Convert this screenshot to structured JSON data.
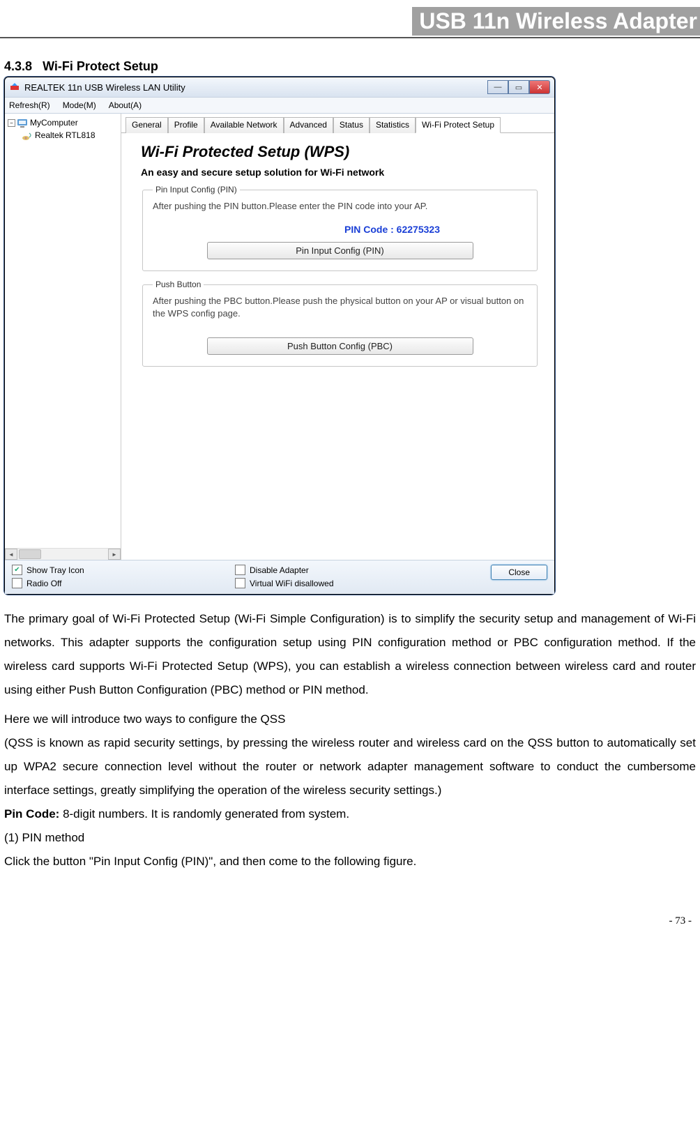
{
  "header": {
    "title": "USB 11n Wireless Adapter"
  },
  "section": {
    "number": "4.3.8",
    "title": "Wi-Fi Protect Setup"
  },
  "window": {
    "title": "REALTEK 11n USB Wireless LAN Utility",
    "menu": {
      "refresh": "Refresh(R)",
      "mode": "Mode(M)",
      "about": "About(A)"
    },
    "tree": {
      "root": "MyComputer",
      "child": "Realtek RTL818"
    },
    "tabs": {
      "general": "General",
      "profile": "Profile",
      "available": "Available Network",
      "advanced": "Advanced",
      "status": "Status",
      "statistics": "Statistics",
      "wps": "Wi-Fi Protect Setup"
    },
    "panel": {
      "heading": "Wi-Fi Protected Setup (WPS)",
      "subheading": "An easy and secure setup solution for Wi-Fi network",
      "pin_group": {
        "legend": "Pin Input Config (PIN)",
        "desc": "After pushing the PIN button.Please enter the PIN code into your AP.",
        "pincode_label": "PIN Code :  62275323",
        "button": "Pin Input Config (PIN)"
      },
      "pbc_group": {
        "legend": "Push Button",
        "desc": "After pushing the PBC button.Please push the physical button on your AP or visual button on the WPS config page.",
        "button": "Push Button Config (PBC)"
      }
    },
    "bottom": {
      "show_tray": "Show Tray Icon",
      "radio_off": "Radio Off",
      "disable_adapter": "Disable Adapter",
      "virtual_wifi": "Virtual WiFi disallowed",
      "close": "Close"
    }
  },
  "body": {
    "p1": "The primary goal of Wi-Fi Protected Setup (Wi-Fi Simple Configuration) is to simplify the security setup and management of Wi-Fi networks. This adapter supports the configuration setup using PIN configuration method or PBC configuration method. If the wireless card supports Wi-Fi Protected Setup (WPS), you can establish a wireless connection between wireless card and router using either Push Button Configuration (PBC) method or PIN method.",
    "p2": "Here we will introduce two ways to configure the QSS",
    "p3": "(QSS is known as rapid security settings, by pressing the wireless router and wireless card on the QSS button to automatically set up WPA2 secure connection level without the router or network adapter management software to conduct the cumbersome interface settings, greatly simplifying the operation of the wireless security settings.)",
    "p4_bold": "Pin Code:",
    "p4_rest": " 8-digit numbers. It is randomly generated from system.",
    "p5": " (1) PIN method",
    "p6": "Click the button \"Pin Input Config (PIN)\", and then come to the following figure."
  },
  "page_number": "- 73 -"
}
